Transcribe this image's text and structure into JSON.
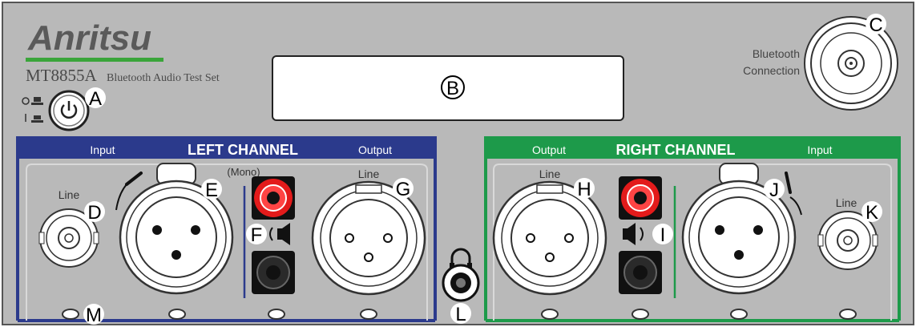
{
  "brand": {
    "logo": "Anritsu",
    "model": "MT8855A",
    "model_desc": "Bluetooth Audio Test Set",
    "accent": "#3aa53a"
  },
  "display": {
    "label": "B"
  },
  "bluetooth": {
    "line1": "Bluetooth",
    "line2": "Connection",
    "callout": "C"
  },
  "power": {
    "callout": "A"
  },
  "left_channel": {
    "title": "LEFT CHANNEL",
    "input_label": "Input",
    "output_label": "Output",
    "line_in_label": "Line",
    "mono_label": "(Mono)",
    "line_out_label": "Line",
    "color": "#2b3a8c"
  },
  "right_channel": {
    "title": "RIGHT CHANNEL",
    "output_label": "Output",
    "input_label": "Input",
    "line_out_label": "Line",
    "line_in_label": "Line",
    "color": "#1d9a4a"
  },
  "callouts": {
    "D": "D",
    "E": "E",
    "F": "F",
    "G": "G",
    "H": "H",
    "I": "I",
    "J": "J",
    "K": "K",
    "L": "L",
    "M": "M"
  }
}
